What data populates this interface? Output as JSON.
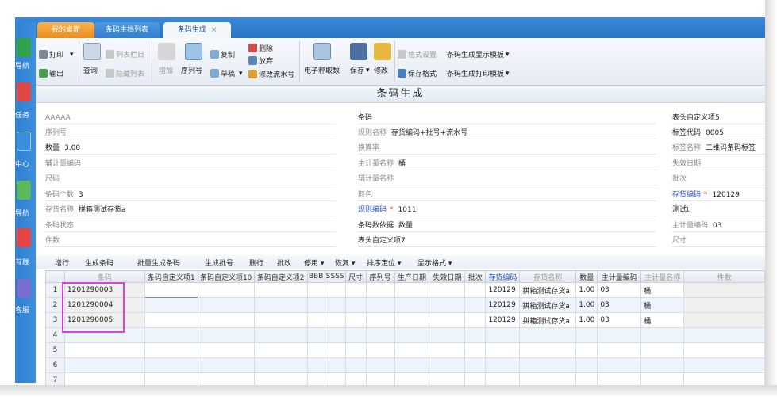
{
  "tabs": [
    {
      "label": "我的桌面"
    },
    {
      "label": "条码主档列表"
    },
    {
      "label": "条码生成",
      "close": "×"
    }
  ],
  "leftnav": [
    {
      "label": "导航",
      "icon": "excel-icon",
      "color": "#2fa24a"
    },
    {
      "label": "任务",
      "icon": "task-icon",
      "color": "#e04848"
    },
    {
      "label": "中心",
      "icon": "center-icon",
      "color": "#3b8fe0"
    },
    {
      "label": "导航",
      "icon": "nav-icon",
      "color": "#5cb85c"
    },
    {
      "label": "互联",
      "icon": "connect-icon",
      "color": "#e54545"
    },
    {
      "label": "客服",
      "icon": "service-icon",
      "color": "#7a6fcf"
    }
  ],
  "toolbar": {
    "print": "打印",
    "export": "输出",
    "query": "查询",
    "list_cols": "列表栏目",
    "hide_list": "隐藏列表",
    "add": "增加",
    "seq": "序列号",
    "copy": "复制",
    "draft": "草稿",
    "delete": "删除",
    "abandon": "放弃",
    "modify_flow": "修改流水号",
    "e_weigh": "电子秤取数",
    "save": "保存",
    "modify": "修改",
    "format_set": "格式设置",
    "save_format": "保存格式",
    "display_tpl": "条码生成显示模板",
    "print_tpl": "条码生成打印模板"
  },
  "page_title": "条码生成",
  "form": {
    "col1": [
      {
        "label": "AAAAA",
        "value": ""
      },
      {
        "label": "序列号",
        "value": ""
      },
      {
        "label": "数量",
        "value": "3.00",
        "bold": true
      },
      {
        "label": "辅计量编码",
        "value": ""
      },
      {
        "label": "尺码",
        "value": ""
      },
      {
        "label": "条码个数",
        "value": "3"
      },
      {
        "label": "存货名称",
        "value": "拼箱测试存货a"
      },
      {
        "label": "条码状态",
        "value": ""
      },
      {
        "label": "件数",
        "value": ""
      }
    ],
    "col2": [
      {
        "label": "条码",
        "value": "",
        "bold": true
      },
      {
        "label": "规则名称",
        "value": "存货编码+批号+流水号"
      },
      {
        "label": "换算率",
        "value": ""
      },
      {
        "label": "主计量名称",
        "value": "桶"
      },
      {
        "label": "辅计量名称",
        "value": ""
      },
      {
        "label": "颜色",
        "value": ""
      },
      {
        "label": "规则编码",
        "value": "1011",
        "link": true,
        "required": "*"
      },
      {
        "label": "条码数依据",
        "value": "数量",
        "bold": true
      },
      {
        "label": "表头自定义项7",
        "value": "",
        "bold": true
      }
    ],
    "col3": [
      {
        "label": "表头自定义项5",
        "value": "",
        "bold": true
      },
      {
        "label": "标签代码",
        "value": "0005",
        "bold": true
      },
      {
        "label": "标签名称",
        "value": "二维码条码标签"
      },
      {
        "label": "失效日期",
        "value": ""
      },
      {
        "label": "批次",
        "value": ""
      },
      {
        "label": "存货编码",
        "value": "120129",
        "link": true,
        "required": "*"
      },
      {
        "label": "测试t",
        "value": "",
        "bold": true
      },
      {
        "label": "主计量编码",
        "value": "03"
      },
      {
        "label": "尺寸",
        "value": ""
      }
    ]
  },
  "grid_toolbar": [
    "增行",
    "生成条码",
    "批量生成条码",
    "生成批号",
    "删行",
    "批改",
    "停用 ▾",
    "恢复 ▾",
    "排序定位 ▾",
    "显示格式 ▾"
  ],
  "grid": {
    "columns": [
      "条码",
      "条码自定义项1",
      "条码自定义项10",
      "条码自定义项2",
      "BBB",
      "SSSS",
      "尺寸",
      "序列号",
      "生产日期",
      "失效日期",
      "批次",
      "存货编码",
      "存货名称",
      "数量",
      "主计量编码",
      "主计量名称",
      "件数"
    ],
    "rows": [
      {
        "n": "1",
        "barcode": "1201290003",
        "inv_code": "120129",
        "inv_name": "拼箱测试存货a",
        "qty": "1.00",
        "unit_code": "03",
        "unit_name": "桶"
      },
      {
        "n": "2",
        "barcode": "1201290004",
        "inv_code": "120129",
        "inv_name": "拼箱测试存货a",
        "qty": "1.00",
        "unit_code": "03",
        "unit_name": "桶"
      },
      {
        "n": "3",
        "barcode": "1201290005",
        "inv_code": "120129",
        "inv_name": "拼箱测试存货a",
        "qty": "1.00",
        "unit_code": "03",
        "unit_name": "桶"
      },
      {
        "n": "4"
      },
      {
        "n": "5"
      },
      {
        "n": "6"
      },
      {
        "n": "7"
      }
    ]
  }
}
